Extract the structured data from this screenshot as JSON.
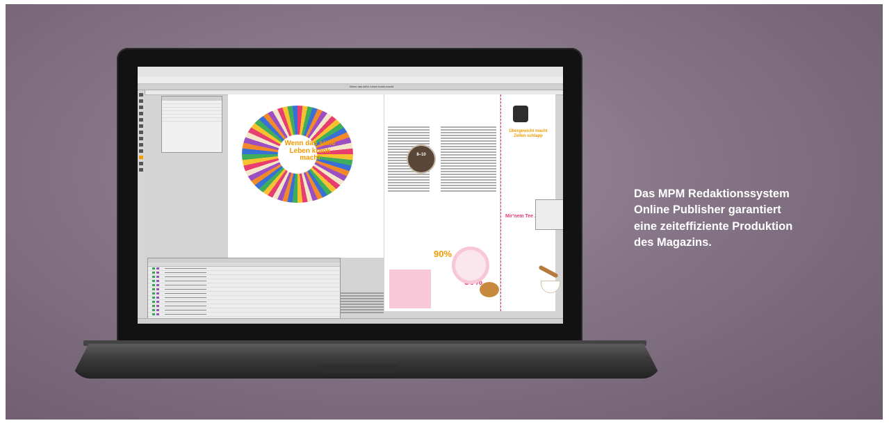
{
  "caption": {
    "lines": [
      "Das MPM Redaktionssystem",
      "Online Publisher garantiert",
      "eine zeiteffiziente Produktion",
      "des Magazins."
    ]
  },
  "app": {
    "doc_title": "Wenn das süße Leben krank macht"
  },
  "magazine": {
    "left_headline": "Wenn das süße Leben krank macht",
    "badge_text": "8–10",
    "right_headline": "Übergewicht macht Zellen schlapp",
    "pink_headline": "Mir'nem Tee Zucker",
    "percent_1": "90%",
    "percent_2": "80%"
  },
  "colors": {
    "background": "#857486",
    "accent_orange": "#f29a00",
    "accent_pink": "#e6397a"
  },
  "icons": [
    "tool-icon",
    "scale-icon",
    "donut-image",
    "muffin-image",
    "sugar-bowl-image"
  ]
}
